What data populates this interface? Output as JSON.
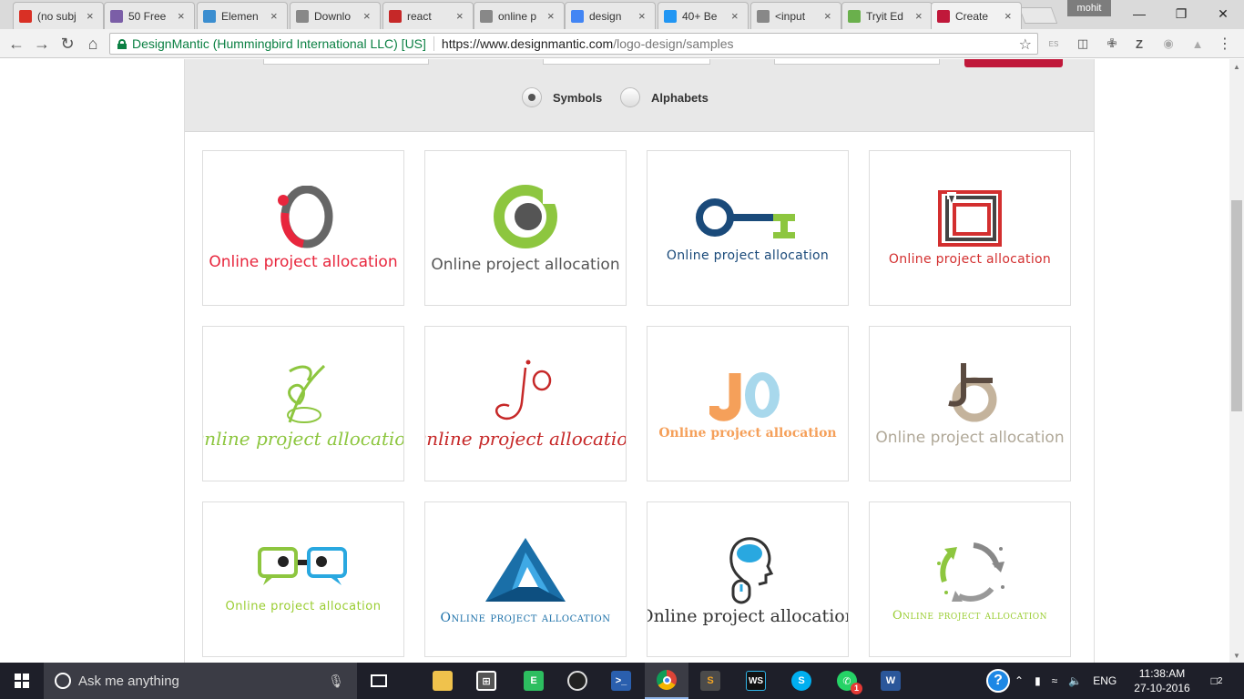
{
  "tabs": [
    {
      "label": "(no subj",
      "color": "#d93025"
    },
    {
      "label": "50 Free",
      "color": "#7b5ea7"
    },
    {
      "label": "Elemen",
      "color": "#3b8ed0"
    },
    {
      "label": "Downlo",
      "color": "#888888"
    },
    {
      "label": "react",
      "color": "#c62828"
    },
    {
      "label": "online p",
      "color": "#888888"
    },
    {
      "label": "design",
      "color": "#4285f4"
    },
    {
      "label": "40+ Be",
      "color": "#2196f3"
    },
    {
      "label": "<input",
      "color": "#888888"
    },
    {
      "label": "Tryit Ed",
      "color": "#6ab04c"
    },
    {
      "label": "Create",
      "color": "#c0183a"
    }
  ],
  "profile": "mohit",
  "address": {
    "secure_label": "DesignMantic (Hummingbird International LLC) [US]",
    "host": "https://www.designmantic.com",
    "path": "/logo-design/samples"
  },
  "extensions": [
    "ES",
    "Z"
  ],
  "filter": {
    "radios": [
      {
        "label": "Symbols",
        "checked": true
      },
      {
        "label": "Alphabets",
        "checked": false
      }
    ]
  },
  "logos": [
    {
      "caption": "Online project allocation",
      "color": "#e8263d",
      "style": "sans"
    },
    {
      "caption": "Online project allocation",
      "color": "#555555",
      "style": "sans"
    },
    {
      "caption": "Online project allocation",
      "color": "#1a4a7a",
      "style": "sans"
    },
    {
      "caption": "Online project allocation",
      "color": "#d32f2f",
      "style": "sans"
    },
    {
      "caption": "Online project allocation",
      "color": "#8dc63f",
      "style": "script"
    },
    {
      "caption": "Online project allocation",
      "color": "#c62828",
      "style": "script"
    },
    {
      "caption": "Online project allocation",
      "color": "#f5a05a",
      "style": "bold"
    },
    {
      "caption": "Online project allocation",
      "color": "#b0a898",
      "style": "sans"
    },
    {
      "caption": "Online project allocation",
      "color": "#9acd32",
      "style": "sans"
    },
    {
      "caption": "Online project allocation",
      "color": "#1a6fa8",
      "style": "smallcaps"
    },
    {
      "caption": "Online project allocation",
      "color": "#333333",
      "style": "sans"
    },
    {
      "caption": "Online project allocation",
      "color": "#9acd32",
      "style": "smallcaps"
    }
  ],
  "taskbar": {
    "search_placeholder": "Ask me anything",
    "lang": "ENG",
    "time": "11:38:AM",
    "date": "27-10-2016",
    "notifications": "2"
  }
}
